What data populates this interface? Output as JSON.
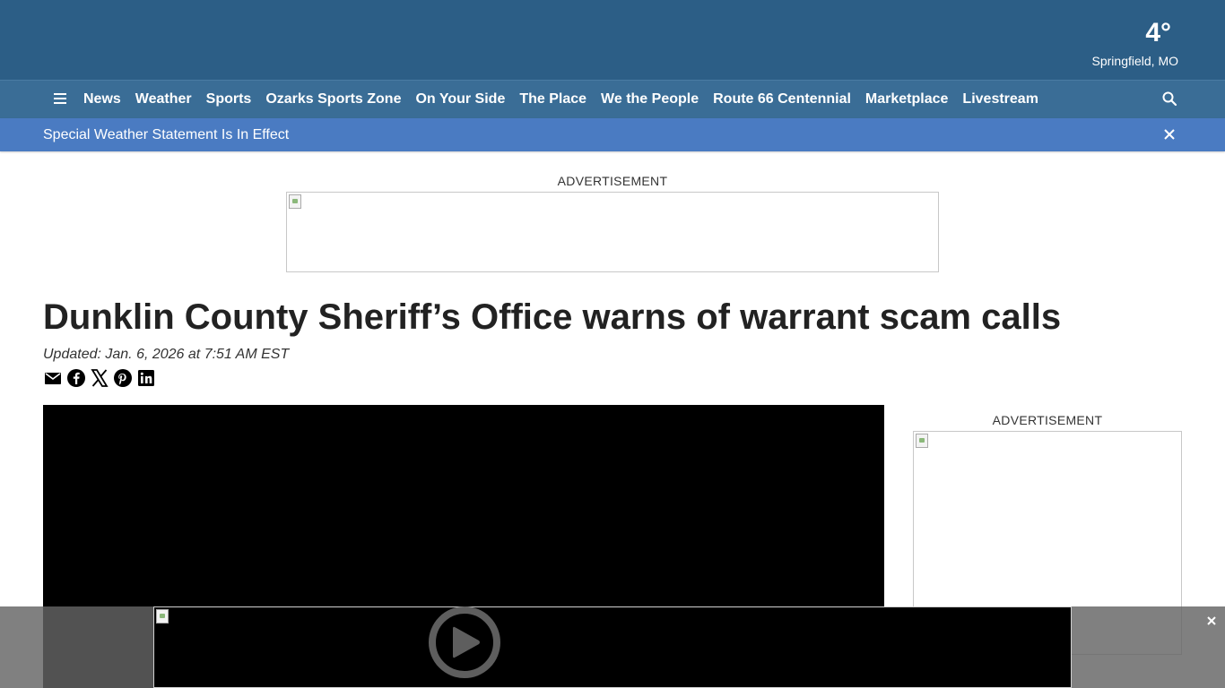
{
  "header": {
    "weather": {
      "temperature": "4°",
      "location": "Springfield, MO"
    }
  },
  "nav": {
    "menu_icon": "hamburger-icon",
    "items": [
      "News",
      "Weather",
      "Sports",
      "Ozarks Sports Zone",
      "On Your Side",
      "The Place",
      "We the People",
      "Route 66 Centennial",
      "Marketplace",
      "Livestream"
    ],
    "search_icon": "search-icon"
  },
  "alert": {
    "text": "Special Weather Statement Is In Effect",
    "close_icon": "close-icon"
  },
  "ads": {
    "top_label": "ADVERTISEMENT",
    "side_label": "ADVERTISEMENT"
  },
  "article": {
    "headline": "Dunklin County Sheriff’s Office warns of warrant scam calls",
    "updated": "Updated: Jan. 6, 2026 at 7:51 AM EST",
    "share_icons": [
      "email-icon",
      "facebook-icon",
      "x-icon",
      "pinterest-icon",
      "linkedin-icon"
    ]
  },
  "sticky_player": {
    "play_icon": "play-icon",
    "close_icon": "close-icon"
  },
  "colors": {
    "header_bg": "#2c5e86",
    "nav_bg": "#3a6d96",
    "alert_bg": "#4a7bc2"
  }
}
